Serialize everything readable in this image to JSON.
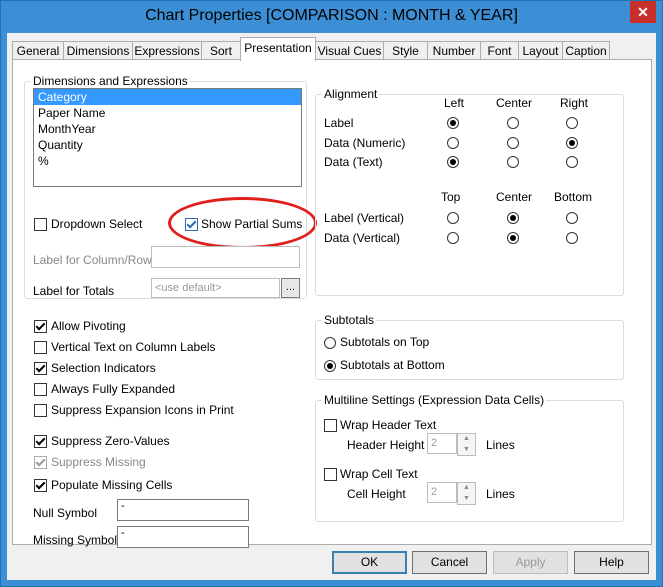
{
  "window": {
    "title": "Chart Properties [COMPARISON : MONTH & YEAR]",
    "close_label": "✕"
  },
  "tabs": [
    "General",
    "Dimensions",
    "Expressions",
    "Sort",
    "Presentation",
    "Visual Cues",
    "Style",
    "Number",
    "Font",
    "Layout",
    "Caption"
  ],
  "active_tab": "Presentation",
  "dims_expr": {
    "legend": "Dimensions and Expressions",
    "items": [
      "Category",
      "Paper Name",
      "MonthYear",
      "Quantity",
      "%"
    ],
    "selected": "Category",
    "dropdown_select": {
      "label": "Dropdown Select",
      "checked": false
    },
    "show_partial_sums": {
      "label": "Show Partial Sums",
      "checked": true
    },
    "label_for_column_row": {
      "label": "Label for Column/Row",
      "value": ""
    },
    "label_for_totals": {
      "label": "Label for Totals",
      "value": "<use default>",
      "browse": "..."
    }
  },
  "alignment": {
    "legend": "Alignment",
    "h_headers": [
      "Left",
      "Center",
      "Right"
    ],
    "h_rows": [
      {
        "label": "Label",
        "selected": "Left"
      },
      {
        "label": "Data (Numeric)",
        "selected": "Right"
      },
      {
        "label": "Data (Text)",
        "selected": "Left"
      }
    ],
    "v_headers": [
      "Top",
      "Center",
      "Bottom"
    ],
    "v_rows": [
      {
        "label": "Label (Vertical)",
        "selected": "Center"
      },
      {
        "label": "Data (Vertical)",
        "selected": "Center"
      }
    ]
  },
  "options": [
    {
      "label": "Allow Pivoting",
      "checked": true,
      "disabled": false
    },
    {
      "label": "Vertical Text on Column Labels",
      "checked": false,
      "disabled": false
    },
    {
      "label": "Selection Indicators",
      "checked": true,
      "disabled": false
    },
    {
      "label": "Always Fully Expanded",
      "checked": false,
      "disabled": false
    },
    {
      "label": "Suppress Expansion Icons in Print",
      "checked": false,
      "disabled": false
    },
    {
      "label": "Suppress Zero-Values",
      "checked": true,
      "disabled": false
    },
    {
      "label": "Suppress Missing",
      "checked": true,
      "disabled": true
    },
    {
      "label": "Populate Missing Cells",
      "checked": true,
      "disabled": false
    }
  ],
  "null_symbol": {
    "label": "Null Symbol",
    "value": "-"
  },
  "missing_symbol": {
    "label": "Missing Symbol",
    "value": "-"
  },
  "subtotals": {
    "legend": "Subtotals",
    "on_top": "Subtotals on Top",
    "at_bottom": "Subtotals at Bottom",
    "selected": "at_bottom"
  },
  "multiline": {
    "legend": "Multiline Settings (Expression Data Cells)",
    "wrap_header": {
      "label": "Wrap Header Text",
      "checked": false
    },
    "header_height": {
      "label": "Header Height",
      "value": "2",
      "unit": "Lines"
    },
    "wrap_cell": {
      "label": "Wrap Cell Text",
      "checked": false
    },
    "cell_height": {
      "label": "Cell Height",
      "value": "2",
      "unit": "Lines"
    }
  },
  "buttons": {
    "ok": "OK",
    "cancel": "Cancel",
    "apply": "Apply",
    "help": "Help"
  },
  "colors": {
    "titlebar": "#3c8fd4",
    "close": "#c7302a",
    "selection": "#3399ff",
    "highlight": "#e0201c"
  }
}
